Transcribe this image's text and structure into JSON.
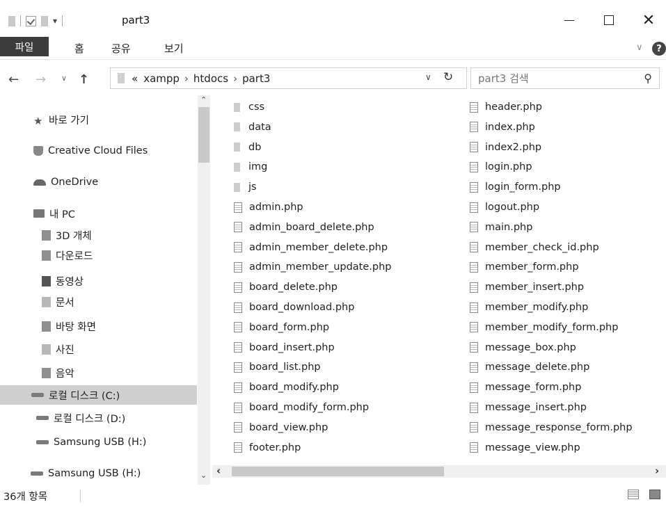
{
  "window": {
    "title": "part3",
    "minimize_icon": "minimize-icon",
    "maximize_icon": "maximize-icon",
    "close_glyph": "✕"
  },
  "ribbon": {
    "tabs": [
      "파일",
      "홈",
      "공유",
      "보기"
    ],
    "help_glyph": "?"
  },
  "address": {
    "prefix": "«",
    "crumbs": [
      "xampp",
      "htdocs",
      "part3"
    ],
    "separator": "›"
  },
  "search": {
    "placeholder": "part3 검색"
  },
  "nav": {
    "quick_access": "바로 가기",
    "creative_cloud": "Creative Cloud Files",
    "onedrive": "OneDrive",
    "pc": "내 PC",
    "pc_children": [
      "3D 개체",
      "다운로드",
      "동영상",
      "문서",
      "바탕 화면",
      "사진",
      "음악",
      "로컬 디스크 (C:)",
      "로컬 디스크 (D:)",
      "Samsung USB (H:)"
    ],
    "usb": "Samsung USB (H:)"
  },
  "files": {
    "column1": [
      {
        "name": "css",
        "type": "folder"
      },
      {
        "name": "data",
        "type": "folder"
      },
      {
        "name": "db",
        "type": "folder"
      },
      {
        "name": "img",
        "type": "folder"
      },
      {
        "name": "js",
        "type": "folder"
      },
      {
        "name": "admin.php",
        "type": "file"
      },
      {
        "name": "admin_board_delete.php",
        "type": "file"
      },
      {
        "name": "admin_member_delete.php",
        "type": "file"
      },
      {
        "name": "admin_member_update.php",
        "type": "file"
      },
      {
        "name": "board_delete.php",
        "type": "file"
      },
      {
        "name": "board_download.php",
        "type": "file"
      },
      {
        "name": "board_form.php",
        "type": "file"
      },
      {
        "name": "board_insert.php",
        "type": "file"
      },
      {
        "name": "board_list.php",
        "type": "file"
      },
      {
        "name": "board_modify.php",
        "type": "file"
      },
      {
        "name": "board_modify_form.php",
        "type": "file"
      },
      {
        "name": "board_view.php",
        "type": "file"
      },
      {
        "name": "footer.php",
        "type": "file"
      }
    ],
    "column2": [
      {
        "name": "header.php",
        "type": "file"
      },
      {
        "name": "index.php",
        "type": "file"
      },
      {
        "name": "index2.php",
        "type": "file"
      },
      {
        "name": "login.php",
        "type": "file"
      },
      {
        "name": "login_form.php",
        "type": "file"
      },
      {
        "name": "logout.php",
        "type": "file"
      },
      {
        "name": "main.php",
        "type": "file"
      },
      {
        "name": "member_check_id.php",
        "type": "file"
      },
      {
        "name": "member_form.php",
        "type": "file"
      },
      {
        "name": "member_insert.php",
        "type": "file"
      },
      {
        "name": "member_modify.php",
        "type": "file"
      },
      {
        "name": "member_modify_form.php",
        "type": "file"
      },
      {
        "name": "message_box.php",
        "type": "file"
      },
      {
        "name": "message_delete.php",
        "type": "file"
      },
      {
        "name": "message_form.php",
        "type": "file"
      },
      {
        "name": "message_insert.php",
        "type": "file"
      },
      {
        "name": "message_response_form.php",
        "type": "file"
      },
      {
        "name": "message_view.php",
        "type": "file"
      }
    ]
  },
  "status": {
    "item_count": "36개 항목"
  },
  "colors": {
    "file_tab_bg": "#3c3c3c",
    "selected_nav_bg": "#cfcfcf"
  }
}
